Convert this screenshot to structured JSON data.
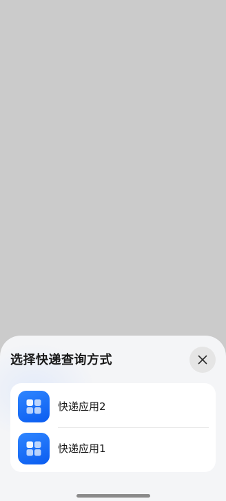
{
  "sheet": {
    "title": "选择快递查询方式",
    "close_icon": "close-icon",
    "options": [
      {
        "label": "快递应用2",
        "icon": "app-grid-icon",
        "icon_color": "#1a6cf6"
      },
      {
        "label": "快递应用1",
        "icon": "app-grid-icon",
        "icon_color": "#1a6cf6"
      }
    ]
  },
  "colors": {
    "backdrop": "#cbcbcb",
    "sheet_background": "#f4f5f7",
    "card_background": "#ffffff",
    "accent": "#1a6cf6"
  }
}
